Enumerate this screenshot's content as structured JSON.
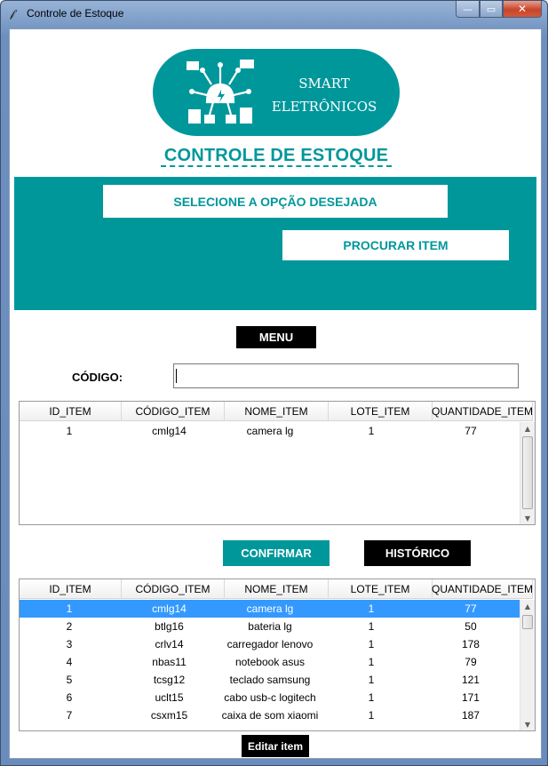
{
  "window": {
    "title": "Controle de Estoque",
    "controls": {
      "minimize": "—",
      "maximize": "▭",
      "close": "✕"
    }
  },
  "logo": {
    "line1": "SMART",
    "line2": "ELETRÔNICOS"
  },
  "page_title": "CONTROLE DE ESTOQUE",
  "panel": {
    "option_label": "SELECIONE A OPÇÃO DESEJADA",
    "search_button": "PROCURAR ITEM"
  },
  "menu_button": "MENU",
  "codigo": {
    "label": "CÓDIGO:",
    "value": ""
  },
  "columns": [
    "ID_ITEM",
    "CÓDIGO_ITEM",
    "NOME_ITEM",
    "LOTE_ITEM",
    "QUANTIDADE_ITEM"
  ],
  "search_results": [
    [
      "1",
      "cmlg14",
      "camera lg",
      "1",
      "77"
    ]
  ],
  "confirm_button": "CONFIRMAR",
  "history_button": "HISTÓRICO",
  "inventory": [
    [
      "1",
      "cmlg14",
      "camera lg",
      "1",
      "77"
    ],
    [
      "2",
      "btlg16",
      "bateria lg",
      "1",
      "50"
    ],
    [
      "3",
      "crlv14",
      "carregador lenovo",
      "1",
      "178"
    ],
    [
      "4",
      "nbas11",
      "notebook asus",
      "1",
      "79"
    ],
    [
      "5",
      "tcsg12",
      "teclado samsung",
      "1",
      "121"
    ],
    [
      "6",
      "uclt15",
      "cabo usb-c logitech",
      "1",
      "171"
    ],
    [
      "7",
      "csxm15",
      "caixa de som xiaomi",
      "1",
      "187"
    ]
  ],
  "selected_row": 0,
  "edit_button": "Editar item",
  "colors": {
    "teal": "#00979b",
    "black": "#000000",
    "selection": "#3399ff"
  }
}
